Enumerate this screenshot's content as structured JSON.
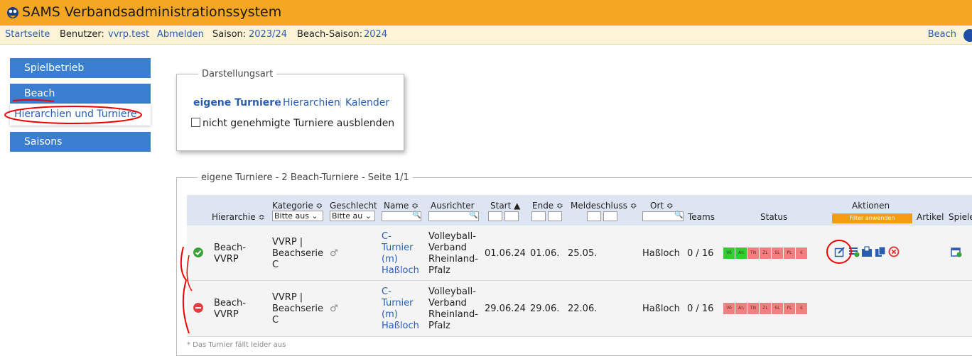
{
  "app": {
    "title": "SAMS Verbandsadministrationssystem"
  },
  "subbar": {
    "home": "Startseite",
    "user_label": "Benutzer:",
    "user": "vvrp.test",
    "logout": "Abmelden",
    "season_label": "Saison:",
    "season": "2023/24",
    "beach_season_label": "Beach-Saison:",
    "beach_season": "2024",
    "right_link": "Beach"
  },
  "sidebar": {
    "items": [
      {
        "label": "Spielbetrieb"
      },
      {
        "label": "Beach"
      },
      {
        "label": "Hierarchien und Turniere"
      },
      {
        "label": "Saisons"
      }
    ]
  },
  "view": {
    "legend": "Darstellungsart",
    "tabs": [
      {
        "label": "eigene Turniere",
        "active": true
      },
      {
        "label": "Hierarchien"
      },
      {
        "label": "Kalender"
      }
    ],
    "checkbox_label": "nicht genehmigte Turniere ausblenden"
  },
  "table": {
    "legend": "eigene Turniere - 2 Beach-Turniere - Seite 1/1",
    "headers": {
      "hierarchie": "Hierarchie ≎",
      "kategorie": "Kategorie ≎",
      "geschlecht": "Geschlecht",
      "name": "Name ≎",
      "ausrichter": "Ausrichter",
      "start": "Start ▲",
      "ende": "Ende ≎",
      "meldeschluss": "Meldeschluss ≎",
      "ort": "Ort ≎",
      "teams": "Teams",
      "status": "Status",
      "aktionen": "Aktionen",
      "artikel": "Artikel",
      "spiele": "Spiele"
    },
    "filters": {
      "kategorie": "Bitte aus ⌄",
      "geschlecht": "Bitte au ⌄",
      "apply": "Filter anwenden"
    },
    "rows": [
      {
        "status": "ok",
        "hierarchie": [
          "Beach-",
          "VVRP"
        ],
        "kategorie": [
          "VVRP |",
          "Beachserie",
          "C"
        ],
        "geschlecht": "♂",
        "name": [
          "C-",
          "Turnier",
          "(m)",
          "Haßloch"
        ],
        "ausrichter": [
          "Volleyball-",
          "Verband",
          "Rheinland-",
          "Pfalz"
        ],
        "start": "01.06.24",
        "ende": "01.06.",
        "meldeschluss": "25.05.",
        "ort": "Haßloch",
        "teams": "0 / 16",
        "badges": [
          "Vö",
          "An",
          "TN",
          "ZL",
          "SL",
          "PL",
          "€"
        ]
      },
      {
        "status": "cancelled",
        "hierarchie": [
          "Beach-",
          "VVRP"
        ],
        "kategorie": [
          "VVRP |",
          "Beachserie",
          "C"
        ],
        "geschlecht": "♂",
        "name": [
          "C-",
          "Turnier",
          "(m)",
          "Haßloch"
        ],
        "ausrichter": [
          "Volleyball-",
          "Verband",
          "Rheinland-",
          "Pfalz"
        ],
        "start": "29.06.24",
        "ende": "29.06.",
        "meldeschluss": "22.06.",
        "ort": "Haßloch",
        "teams": "0 / 16",
        "badges": [
          "Vö",
          "An",
          "TN",
          "ZL",
          "SL",
          "PL",
          "€"
        ]
      }
    ],
    "footnote": "* Das Turnier fällt leider aus"
  },
  "colors": {
    "accent": "#f5a623",
    "nav": "#3a7ecf",
    "link": "#2a5db0",
    "ok": "#3aa03a",
    "cancel": "#e03c3c",
    "badge_green": "#33cc33",
    "badge_red": "#f08080"
  }
}
